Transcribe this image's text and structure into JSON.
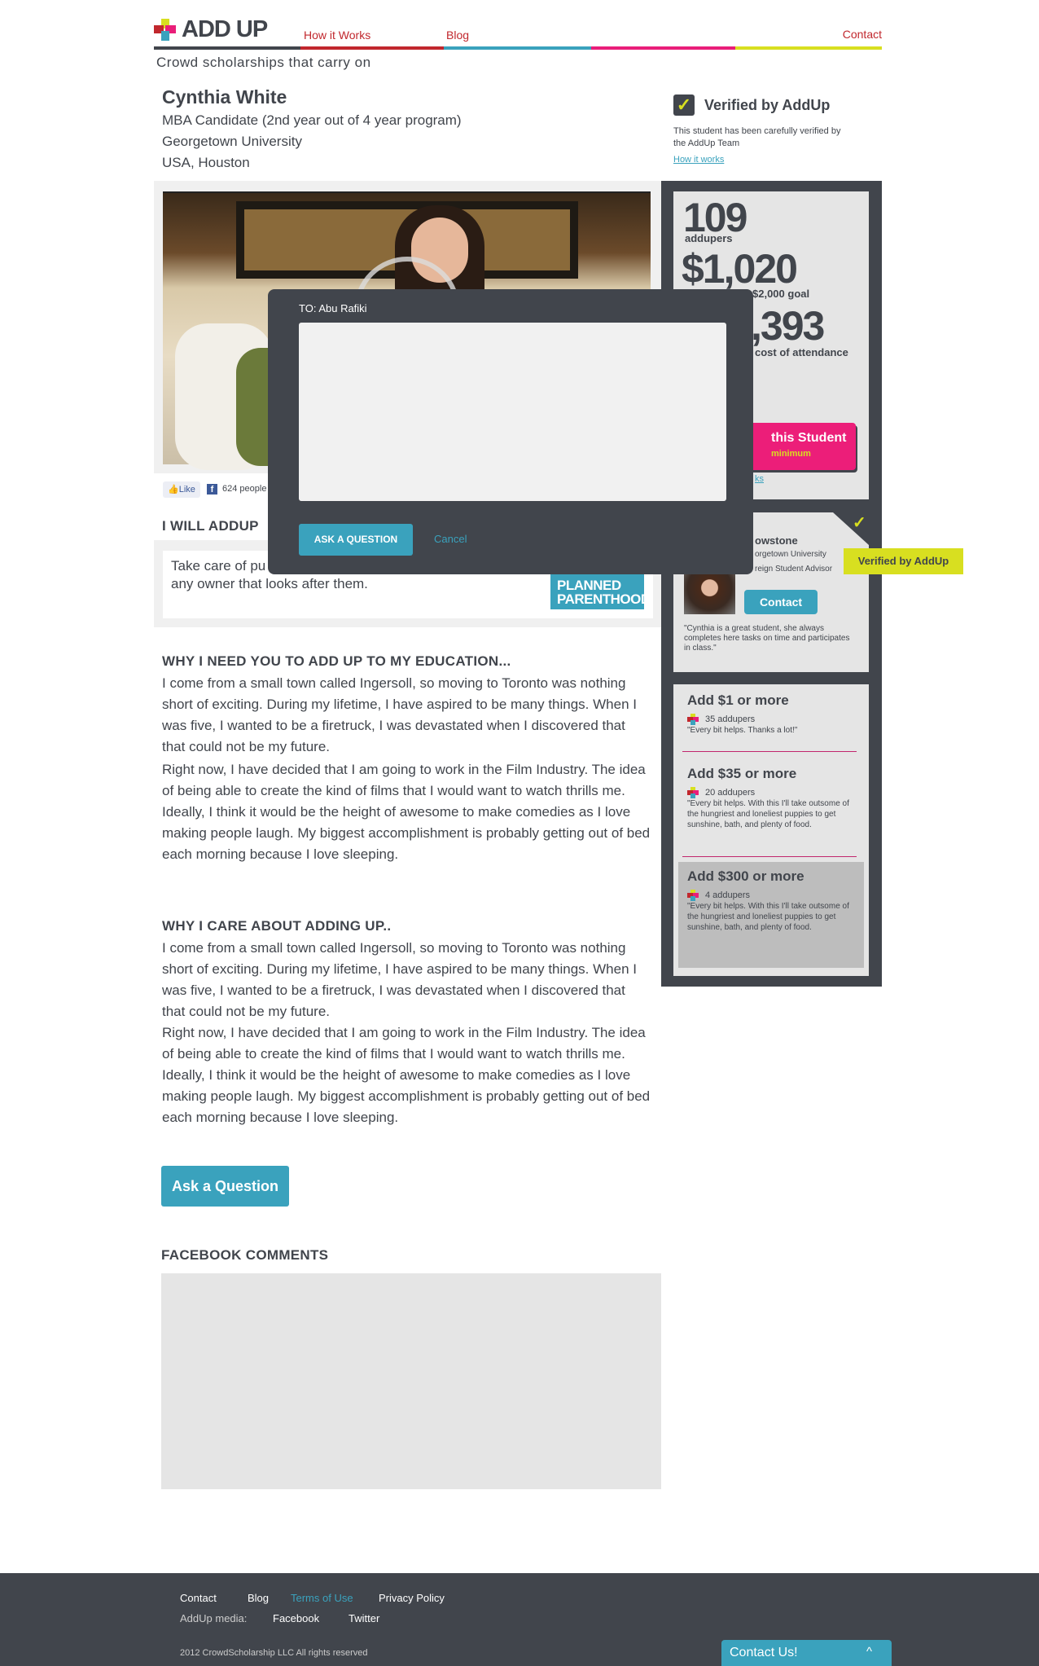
{
  "header": {
    "logo_text": "ADD UP",
    "tagline": "Crowd scholarships that carry on",
    "nav": {
      "how_it_works": "How it Works",
      "blog": "Blog",
      "contact": "Contact"
    },
    "stripe_colors": [
      "#41454c",
      "#c1272d",
      "#3aa2bd",
      "#e91e79",
      "#d8df20"
    ]
  },
  "student": {
    "name": "Cynthia White",
    "program": "MBA Candidate (2nd year out of 4 year program)",
    "school": "Georgetown University",
    "location": "USA, Houston"
  },
  "verified": {
    "title": "Verified by AddUp",
    "text": "This student has been carefully verified by the AddUp Team",
    "link": "How it works"
  },
  "social": {
    "like": "Like",
    "count_text": "624 people"
  },
  "cause": {
    "heading": "I WILL ADDUP",
    "text_start": "Take care of pu",
    "text_end": "any owner that looks after them.",
    "logo_line1": "PLANNED",
    "logo_line2": "PARENTHOOD"
  },
  "stats": {
    "addupers": "109",
    "addupers_label": "addupers",
    "raised": "$1,020",
    "goal_label": "$2,000 goal",
    "cost": ",393",
    "cost_label": "cost of attendance",
    "cta": "this Student",
    "cta_sub": "minimum",
    "link": "ks"
  },
  "advisor": {
    "name": "owstone",
    "school": "orgetown University",
    "role": "reign Student Advisor",
    "contact": "Contact",
    "quote": "\"Cynthia is a great student, she always completes here tasks on time and participates in class.\"",
    "tooltip": "Verified by AddUp"
  },
  "rewards": [
    {
      "title": "Add $1 or more",
      "count": "35 addupers",
      "text": "\"Every bit helps. Thanks a lot!\""
    },
    {
      "title": "Add $35 or more",
      "count": "20 addupers",
      "text": "\"Every bit helps. With this I'll take outsome of the hungriest and loneliest puppies to get sunshine, bath, and plenty of food."
    },
    {
      "title": "Add $300 or more",
      "count": "4 addupers",
      "text": "\"Every bit helps. With this I'll take outsome of the hungriest and loneliest puppies to get sunshine, bath, and plenty of food."
    }
  ],
  "why_need": {
    "heading": "WHY I NEED YOU TO ADD UP TO MY EDUCATION...",
    "p1": "I come from a small town called Ingersoll, so moving to Toronto was nothing short of exciting. During my lifetime, I have aspired to be many things. When I was five, I wanted to be a firetruck, I was devastated when I discovered that that could not be my future.",
    "p2": "Right now, I have decided that I am going to work in the Film Industry. The idea of being able to create the kind of films that I would want to watch thrills me. Ideally, I think it would be the height of awesome to make comedies as I love making people laugh. My biggest accomplishment is probably getting out of bed each morning because I love sleeping."
  },
  "why_care": {
    "heading": "WHY I CARE ABOUT ADDING UP..",
    "p1": "I come from a small town called Ingersoll, so moving to Toronto was nothing short of exciting. During my lifetime, I have aspired to be many things. When I was five, I wanted to be a firetruck, I was devastated when I discovered that that could not be my future.",
    "p2": "Right now, I have decided that I am going to work in the Film Industry. The idea of being able to create the kind of films that I would want to watch thrills me. Ideally, I think it would be the height of awesome to make comedies as I love making people laugh. My biggest accomplishment is probably getting out of bed each morning because I love sleeping."
  },
  "ask_button": "Ask a Question",
  "facebook_heading": "FACEBOOK COMMENTS",
  "modal": {
    "to": "TO: Abu Rafiki",
    "message_value": "",
    "submit": "ASK A QUESTION",
    "cancel": "Cancel"
  },
  "footer": {
    "links": [
      "Contact",
      "Blog",
      "Terms of Use",
      "Privacy Policy"
    ],
    "media_label": "AddUp media:",
    "media": [
      "Facebook",
      "Twitter"
    ],
    "copyright": "2012 CrowdScholarship LLC All rights reserved",
    "contact_tab": "Contact Us!"
  }
}
